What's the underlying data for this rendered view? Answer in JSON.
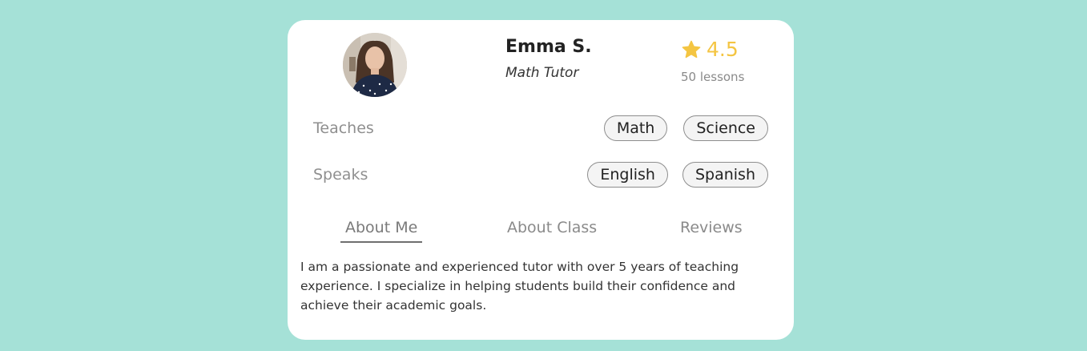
{
  "tutor": {
    "name": "Emma S.",
    "role": "Math Tutor",
    "rating": "4.5",
    "lessons": "50 lessons"
  },
  "teaches": {
    "label": "Teaches",
    "subjects": [
      "Math",
      "Science"
    ]
  },
  "speaks": {
    "label": "Speaks",
    "languages": [
      "English",
      "Spanish"
    ]
  },
  "tabs": [
    {
      "label": "About Me",
      "active": true
    },
    {
      "label": "About Class",
      "active": false
    },
    {
      "label": "Reviews",
      "active": false
    }
  ],
  "about": {
    "text": "I am a passionate and experienced tutor with over 5 years of teaching experience. I specialize in helping students build their confidence and achieve their academic goals."
  },
  "icons": {
    "rating": "star-icon"
  },
  "colors": {
    "background": "#a5e1d7",
    "card": "#ffffff",
    "rating": "#f4c542",
    "tab_active_underline": "#6f6f6f"
  }
}
